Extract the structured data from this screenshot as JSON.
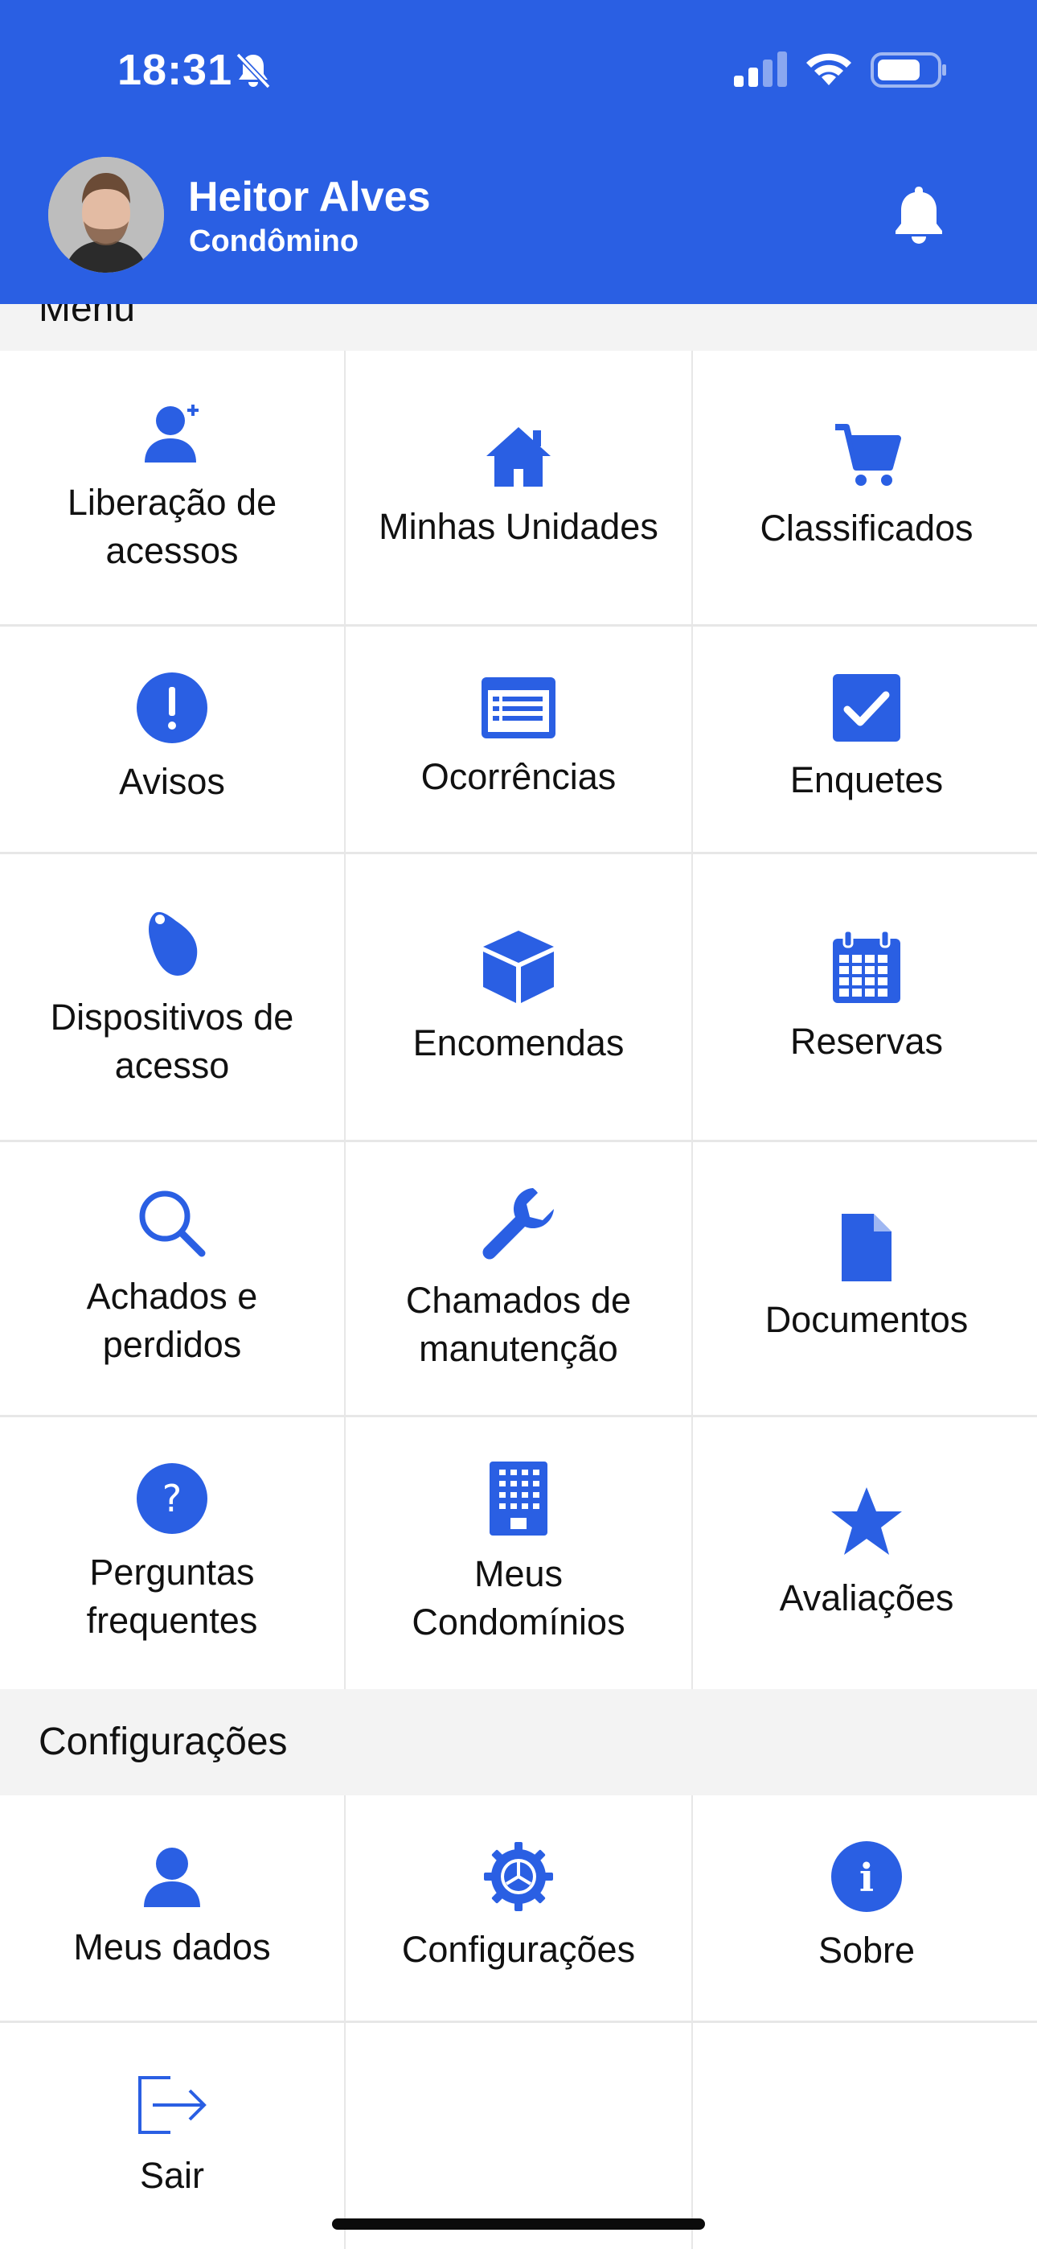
{
  "status_bar": {
    "time": "18:31",
    "icons": [
      "bell-off-icon",
      "signal-icon",
      "wifi-icon",
      "battery-icon"
    ]
  },
  "header": {
    "user_name": "Heitor Alves",
    "user_role": "Condômino",
    "icons": [
      "avatar",
      "bell-icon"
    ]
  },
  "colors": {
    "primary": "#2a5fe3",
    "section_bg": "#f3f3f3",
    "divider": "#e7e7e7",
    "text": "#111111"
  },
  "menu": {
    "section_label": "Menu",
    "items": [
      {
        "label": "Liberação de\nacessos",
        "icon": "add-user-icon"
      },
      {
        "label": "Minhas Unidades",
        "icon": "home-icon"
      },
      {
        "label": "Classificados",
        "icon": "cart-icon"
      },
      {
        "label": "Avisos",
        "icon": "alert-icon"
      },
      {
        "label": "Ocorrências",
        "icon": "list-icon"
      },
      {
        "label": "Enquetes",
        "icon": "checkbox-icon"
      },
      {
        "label": "Dispositivos de\nacesso",
        "icon": "tag-icon"
      },
      {
        "label": "Encomendas",
        "icon": "box-icon"
      },
      {
        "label": "Reservas",
        "icon": "calendar-icon"
      },
      {
        "label": "Achados e\nperdidos",
        "icon": "search-icon"
      },
      {
        "label": "Chamados de\nmanutenção",
        "icon": "wrench-icon"
      },
      {
        "label": "Documentos",
        "icon": "document-icon"
      },
      {
        "label": "Perguntas\nfrequentes",
        "icon": "question-icon"
      },
      {
        "label": "Meus\nCondomínios",
        "icon": "building-icon"
      },
      {
        "label": "Avaliações",
        "icon": "star-icon"
      }
    ]
  },
  "settings": {
    "section_label": "Configurações",
    "items": [
      {
        "label": "Meus dados",
        "icon": "user-icon"
      },
      {
        "label": "Configurações",
        "icon": "gear-icon"
      },
      {
        "label": "Sobre",
        "icon": "info-icon"
      },
      {
        "label": "Sair",
        "icon": "logout-icon"
      }
    ]
  }
}
